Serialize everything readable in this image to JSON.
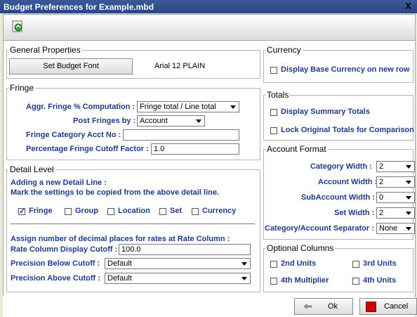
{
  "window": {
    "title": "Budget Preferences for Example.mbd",
    "close_glyph": "X"
  },
  "general": {
    "legend": "General Properties",
    "font_button": "Set Budget Font",
    "font_value": "Arial  12  PLAIN"
  },
  "fringe": {
    "legend": "Fringe",
    "aggr_label": "Aggr. Fringe % Computation :",
    "aggr_value": "Fringe total / Line total",
    "post_label": "Post Fringes by :",
    "post_value": "Account",
    "category_label": "Fringe Category Acct No :",
    "category_value": "",
    "cutoff_label": "Percentage Fringe Cutoff Factor :",
    "cutoff_value": "1.0"
  },
  "detail": {
    "legend": "Detail Level",
    "intro1": "Adding a new Detail Line :",
    "intro2": "Mark the settings to be copied from the above detail line.",
    "checks": [
      {
        "label": "Fringe",
        "checked": true
      },
      {
        "label": "Group",
        "checked": false
      },
      {
        "label": "Location",
        "checked": false
      },
      {
        "label": "Set",
        "checked": false
      },
      {
        "label": "Currency",
        "checked": false
      }
    ],
    "rate_intro": "Assign number of decimal places for rates at Rate Column :",
    "rate_cutoff_label": "Rate Column Display Cutoff :",
    "rate_cutoff_value": "100.0",
    "below_label": "Precision Below Cutoff :",
    "below_value": "Default",
    "above_label": "Precision Above Cutoff :",
    "above_value": "Default"
  },
  "currency": {
    "legend": "Currency",
    "display_base": "Display Base Currency on new row"
  },
  "totals": {
    "legend": "Totals",
    "summary": "Display Summary Totals",
    "lock": "Lock Original Totals for Comparison"
  },
  "account_format": {
    "legend": "Account Format",
    "category_label": "Category Width :",
    "category_value": "2",
    "account_label": "Account Width :",
    "account_value": "2",
    "subaccount_label": "SubAccount Width :",
    "subaccount_value": "0",
    "set_label": "Set Width :",
    "set_value": "2",
    "separator_label": "Category/Account Separator :",
    "separator_value": "None"
  },
  "optional": {
    "legend": "Optional Columns",
    "second_units": "2nd Units",
    "third_units": "3rd Units",
    "fourth_multiplier": "4th Multiplier",
    "fourth_units": "4th Units"
  },
  "buttons": {
    "ok": "Ok",
    "cancel": "Cancel",
    "cancel_color": "#cc0000"
  }
}
